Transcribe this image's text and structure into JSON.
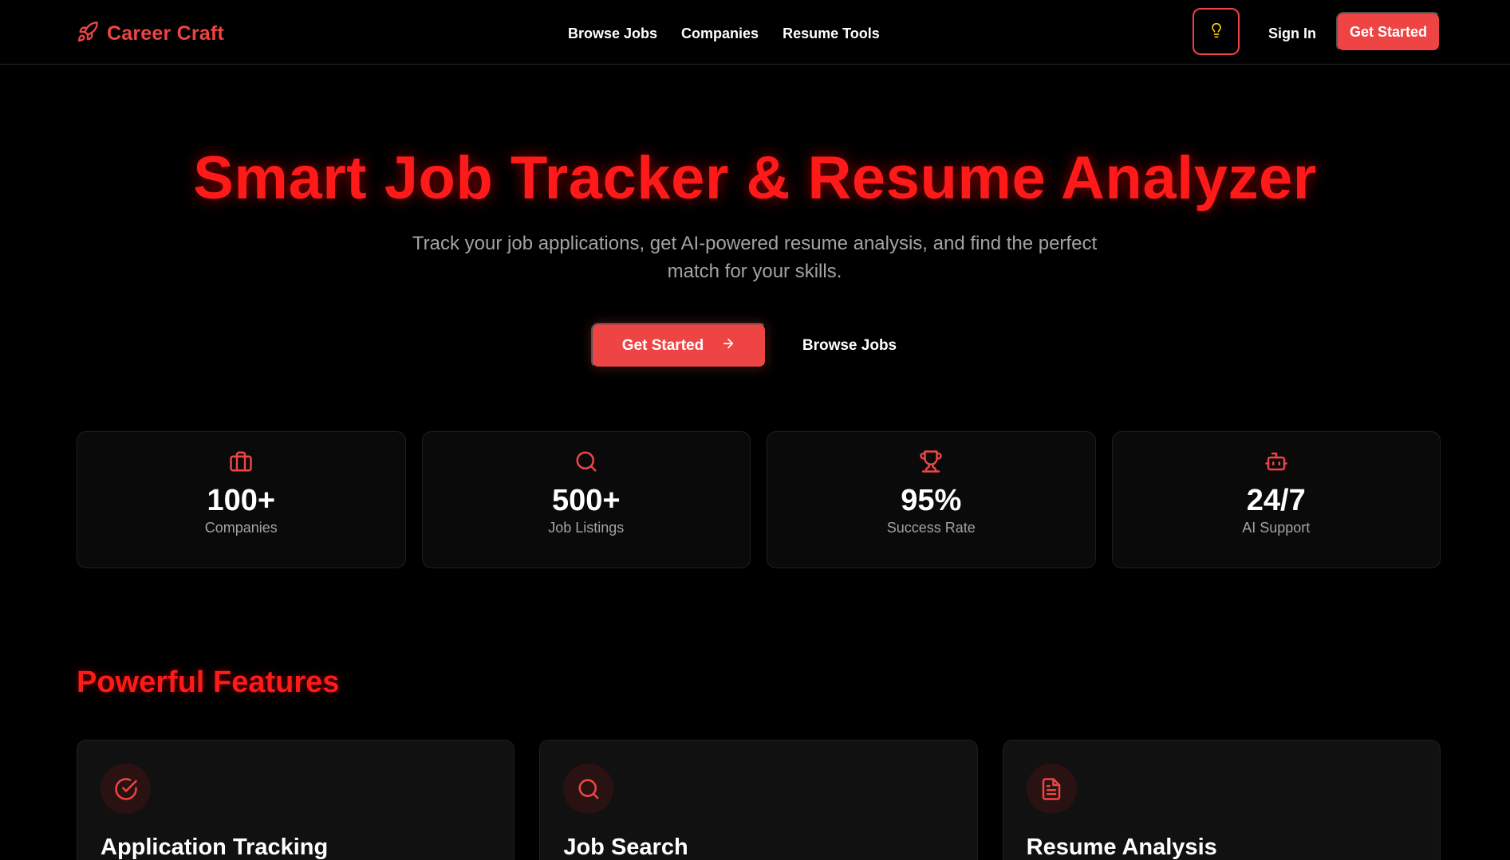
{
  "brand": {
    "name": "Career Craft",
    "icon": "rocket-icon",
    "color": "#ef4444"
  },
  "nav": {
    "links": [
      "Browse Jobs",
      "Companies",
      "Resume Tools"
    ],
    "theme_icon": "lightbulb-icon",
    "sign_in": "Sign In",
    "cta": "Get Started"
  },
  "hero": {
    "title": "Smart Job Tracker & Resume Analyzer",
    "subtitle": "Track your job applications, get AI-powered resume analysis, and find the perfect match for your skills.",
    "cta": "Get Started",
    "cta_icon": "arrow-right-icon",
    "secondary": "Browse Jobs"
  },
  "stats": [
    {
      "icon": "briefcase-icon",
      "value": "100+",
      "label": "Companies"
    },
    {
      "icon": "search-icon",
      "value": "500+",
      "label": "Job Listings"
    },
    {
      "icon": "trophy-icon",
      "value": "95%",
      "label": "Success Rate"
    },
    {
      "icon": "bot-icon",
      "value": "24/7",
      "label": "AI Support"
    }
  ],
  "features": {
    "title": "Powerful Features",
    "items": [
      {
        "icon": "check-circle-icon",
        "title": "Application Tracking"
      },
      {
        "icon": "search-icon",
        "title": "Job Search"
      },
      {
        "icon": "file-text-icon",
        "title": "Resume Analysis"
      }
    ]
  },
  "colors": {
    "accent": "#ef4444",
    "heading_red": "#ff1a1a",
    "background": "#000000",
    "card": "#0a0a0a",
    "muted_text": "#a3a3a3",
    "bulb": "#facc15"
  }
}
